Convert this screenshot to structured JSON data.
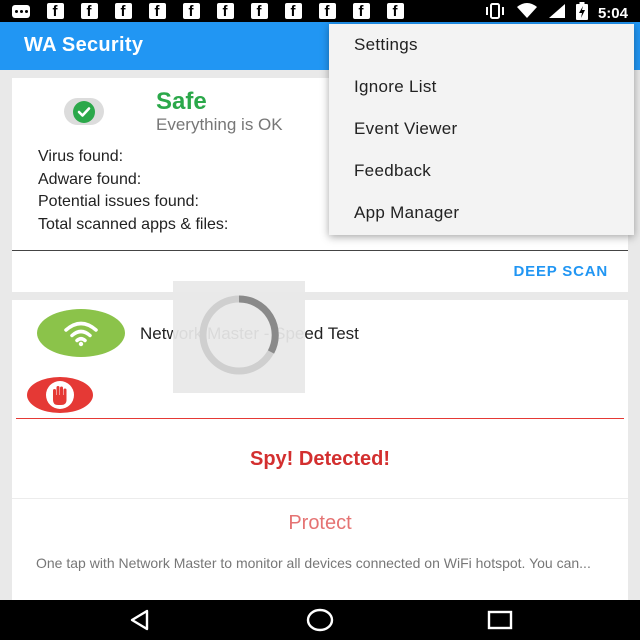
{
  "status_bar": {
    "time": "5:04",
    "notification_icons": [
      "message-icon",
      "facebook-icon",
      "facebook-icon",
      "facebook-icon",
      "facebook-icon",
      "facebook-icon",
      "facebook-icon",
      "facebook-icon",
      "facebook-icon",
      "facebook-icon",
      "facebook-icon",
      "facebook-icon"
    ],
    "facebook_glyph": "f",
    "system_icons": [
      "vibrate-icon",
      "wifi-icon",
      "signal-icon",
      "battery-charging-icon"
    ]
  },
  "app_bar": {
    "title": "WA Security",
    "color": "#2196f3"
  },
  "scan_card": {
    "status_title": "Safe",
    "status_subtitle": "Everything is OK",
    "status_color": "#2ba84a",
    "stats": [
      {
        "label": "Virus found:"
      },
      {
        "label": "Adware found:"
      },
      {
        "label": "Potential issues found:"
      },
      {
        "label": "Total scanned apps & files:"
      }
    ],
    "deep_scan_label": "DEEP SCAN"
  },
  "network_card": {
    "title": "Network Master - Speed Test",
    "alert_text": "Spy! Detected!",
    "protect_label": "Protect",
    "description": "One tap with Network Master to monitor all devices connected on WiFi hotspot. You can...",
    "alert_color": "#d32f2f"
  },
  "overflow_menu": {
    "items": [
      "Settings",
      "Ignore List",
      "Event Viewer",
      "Feedback",
      "App Manager"
    ]
  },
  "loading": {
    "icon": "spinner-icon"
  },
  "nav_bar": {
    "buttons": [
      "back-icon",
      "home-icon",
      "recents-icon"
    ]
  }
}
